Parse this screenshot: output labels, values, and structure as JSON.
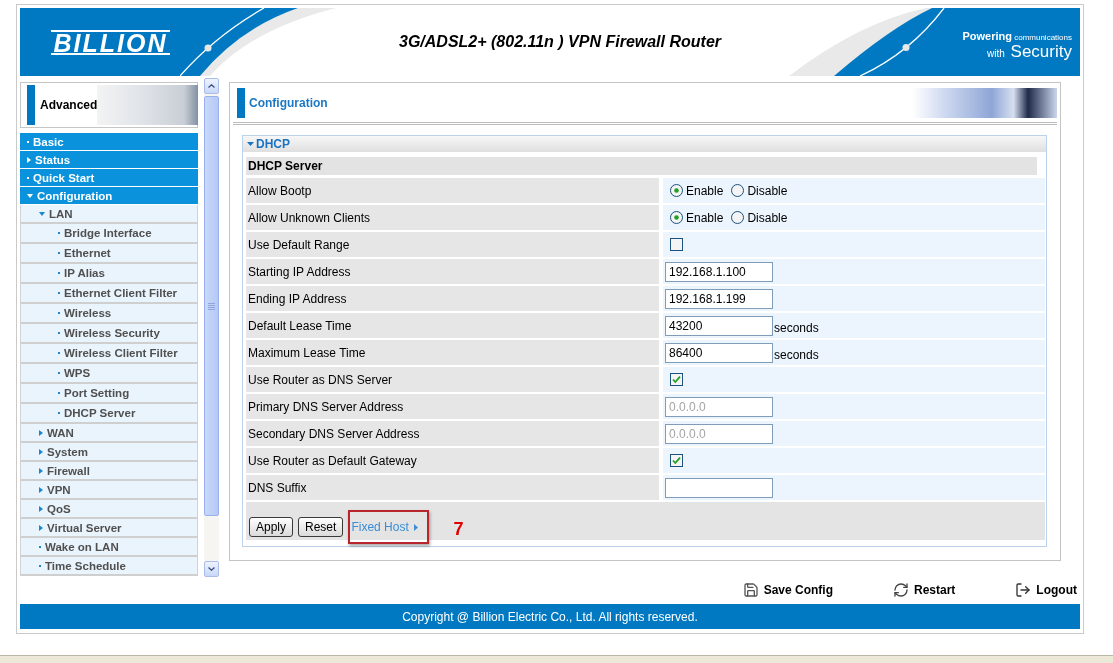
{
  "header": {
    "logo": "BILLION",
    "title": "3G/ADSL2+ (802.11n ) VPN Firewall Router",
    "slogan": [
      "**Powering** communications",
      "with **Security**"
    ]
  },
  "sidebar": {
    "heading": "Advanced",
    "items": [
      {
        "label": "Basic",
        "kind": "link"
      },
      {
        "label": "Status",
        "kind": "group",
        "expanded": false
      },
      {
        "label": "Quick Start",
        "kind": "link"
      },
      {
        "label": "Configuration",
        "kind": "group",
        "expanded": true,
        "children": [
          {
            "label": "LAN",
            "kind": "group",
            "expanded": true,
            "children": [
              {
                "label": "Bridge Interface",
                "kind": "link"
              },
              {
                "label": "Ethernet",
                "kind": "link"
              },
              {
                "label": "IP Alias",
                "kind": "link"
              },
              {
                "label": "Ethernet Client Filter",
                "kind": "link"
              },
              {
                "label": "Wireless",
                "kind": "link"
              },
              {
                "label": "Wireless Security",
                "kind": "link"
              },
              {
                "label": "Wireless Client Filter",
                "kind": "link"
              },
              {
                "label": "WPS",
                "kind": "link"
              },
              {
                "label": "Port Setting",
                "kind": "link"
              },
              {
                "label": "DHCP Server",
                "kind": "link"
              }
            ]
          },
          {
            "label": "WAN",
            "kind": "group",
            "expanded": false
          },
          {
            "label": "System",
            "kind": "group",
            "expanded": false
          },
          {
            "label": "Firewall",
            "kind": "group",
            "expanded": false
          },
          {
            "label": "VPN",
            "kind": "group",
            "expanded": false
          },
          {
            "label": "QoS",
            "kind": "group",
            "expanded": false
          },
          {
            "label": "Virtual Server",
            "kind": "group",
            "expanded": false
          },
          {
            "label": "Wake on LAN",
            "kind": "link"
          },
          {
            "label": "Time Schedule",
            "kind": "link"
          }
        ]
      }
    ]
  },
  "page": {
    "title": "Configuration"
  },
  "section": {
    "title": "DHCP",
    "expanded": true,
    "subtitle": "DHCP Server",
    "rows": [
      {
        "label": "Allow Bootp",
        "kind": "radio",
        "options": [
          {
            "label": "Enable",
            "selected": true
          },
          {
            "label": "Disable",
            "selected": false
          }
        ]
      },
      {
        "label": "Allow Unknown Clients",
        "kind": "radio",
        "options": [
          {
            "label": "Enable",
            "selected": true
          },
          {
            "label": "Disable",
            "selected": false
          }
        ]
      },
      {
        "label": "Use Default Range",
        "kind": "checkbox",
        "checked": false
      },
      {
        "label": "Starting IP Address",
        "kind": "text",
        "value": "192.168.1.100",
        "disabled": false
      },
      {
        "label": "Ending IP Address",
        "kind": "text",
        "value": "192.168.1.199",
        "disabled": false
      },
      {
        "label": "Default Lease Time",
        "kind": "text",
        "value": "43200",
        "unit": "seconds",
        "disabled": false
      },
      {
        "label": "Maximum Lease Time",
        "kind": "text",
        "value": "86400",
        "unit": "seconds",
        "disabled": false
      },
      {
        "label": "Use Router as DNS Server",
        "kind": "checkbox",
        "checked": true
      },
      {
        "label": "Primary DNS Server Address",
        "kind": "text",
        "value": "0.0.0.0",
        "disabled": true
      },
      {
        "label": "Secondary DNS Server Address",
        "kind": "text",
        "value": "0.0.0.0",
        "disabled": true
      },
      {
        "label": "Use Router as Default Gateway",
        "kind": "checkbox",
        "checked": true
      },
      {
        "label": "DNS Suffix",
        "kind": "text",
        "disabled": false
      }
    ],
    "buttons": [
      "Apply",
      "Reset"
    ],
    "link": {
      "label": "Fixed Host",
      "highlighted": true
    },
    "annotation": "7"
  },
  "actions": [
    {
      "label": "Save Config",
      "kind": "save"
    },
    {
      "label": "Restart",
      "kind": "restart"
    },
    {
      "label": "Logout",
      "kind": "logout"
    }
  ],
  "footer": {
    "copyright": "Copyright @ Billion Electric Co., Ltd. All rights reserved."
  }
}
